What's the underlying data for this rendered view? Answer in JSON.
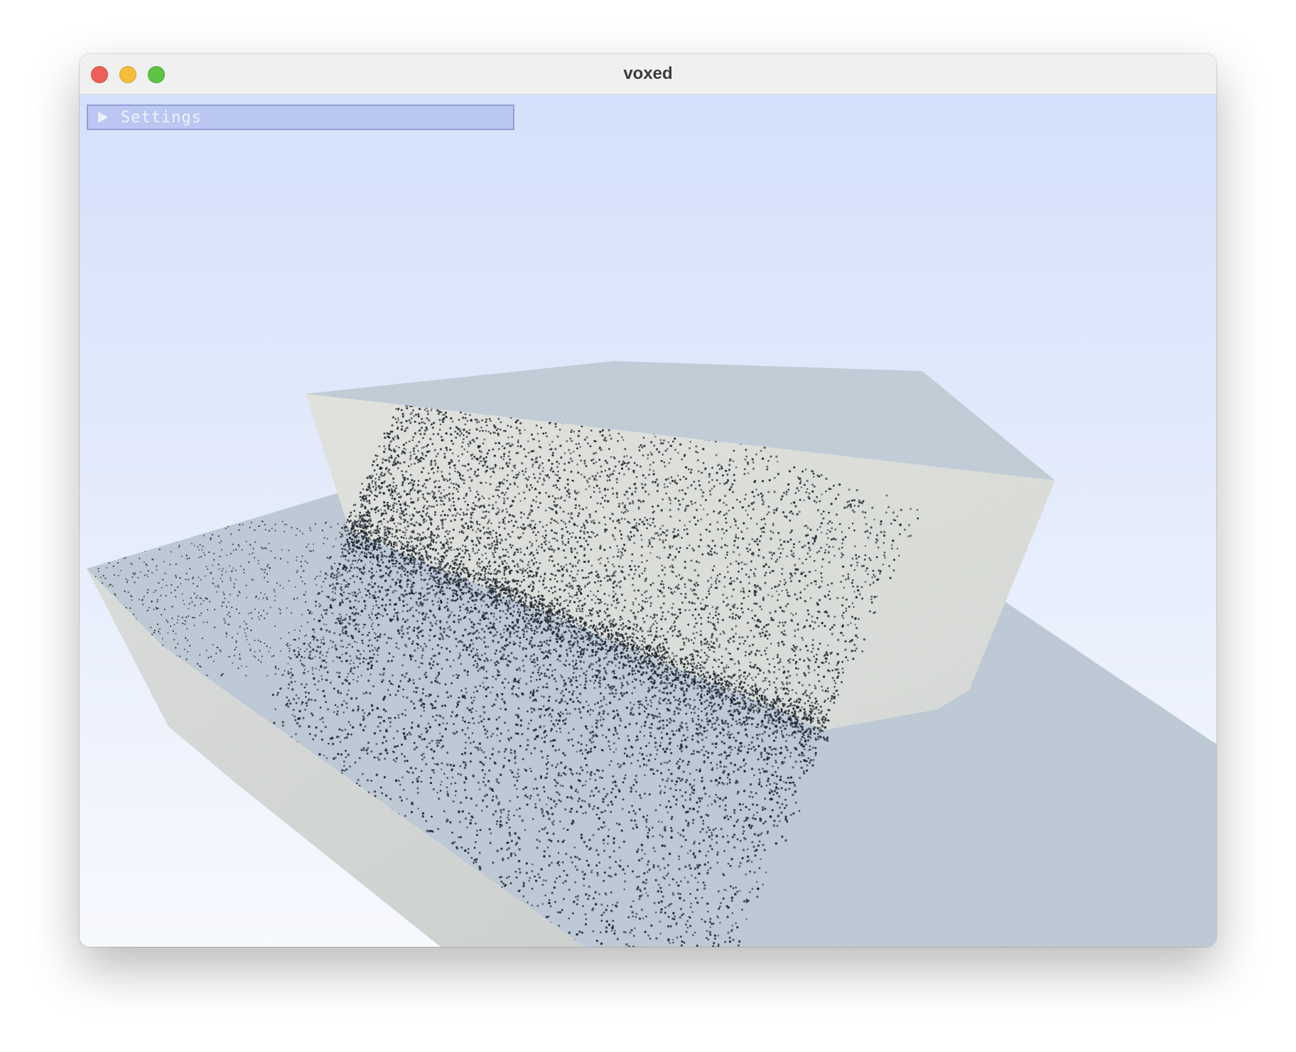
{
  "window": {
    "title": "voxed",
    "controls": [
      "close",
      "minimize",
      "maximize"
    ]
  },
  "settings_panel": {
    "label": "Settings",
    "collapsed": true,
    "icon": "triangle-right-icon"
  },
  "colors": {
    "sky_top": "#d4e0fb",
    "sky_bottom": "#f7f9fe",
    "voxel_top_face": "#bccad7",
    "voxel_side_face": "#d9dcd9",
    "voxel_wall_face": "#dfe1dd",
    "speckle": "#1d2530",
    "close_button": "#ee5f57",
    "minimize_button": "#f6bd3b",
    "maximize_button": "#5ec342"
  }
}
